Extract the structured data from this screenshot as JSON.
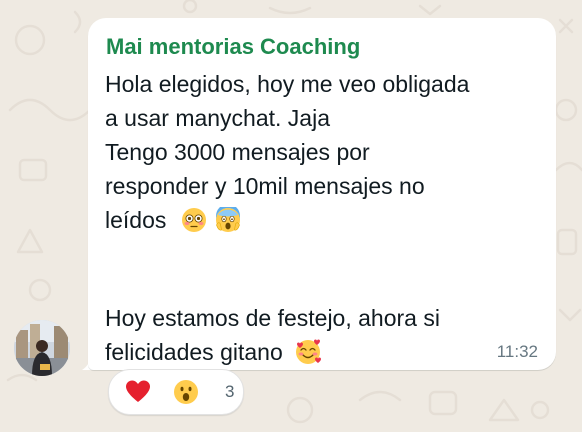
{
  "message": {
    "sender": "Mai mentorias Coaching",
    "lines": [
      "Hola elegidos, hoy me veo obligada",
      "a usar manychat. Jaja",
      "Tengo 3000 mensajes por",
      "responder y 10mil mensajes no",
      "leídos",
      "Hoy estamos de festejo, ahora si",
      "felicidades gitano"
    ],
    "emojis": [
      "flushed-face-emoji",
      "face-screaming-in-fear-emoji",
      "smiling-face-with-hearts-emoji"
    ],
    "time": "11:32"
  },
  "reactions": {
    "emojis": [
      "red-heart-emoji",
      "face-with-open-mouth-emoji"
    ],
    "count": "3"
  },
  "colors": {
    "sender": "#1e8a4f",
    "background": "#efeae2",
    "bubble": "#ffffff",
    "timestamp": "#667781"
  }
}
